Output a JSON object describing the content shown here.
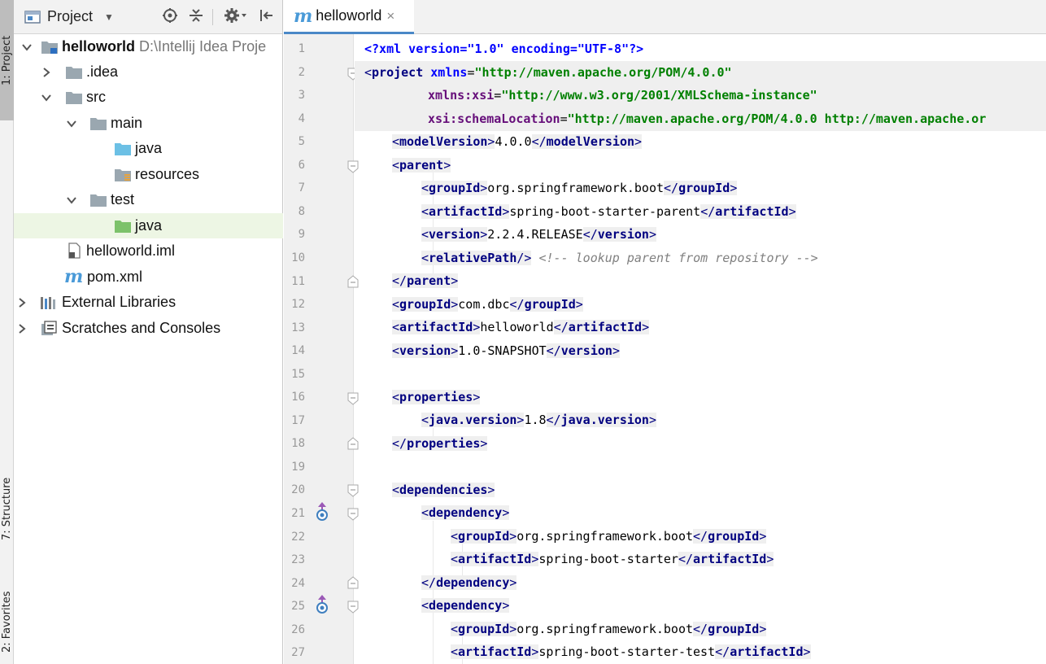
{
  "strip": {
    "tab_project": "1: Project",
    "tab_structure": "7: Structure",
    "tab_favorites": "2: Favorites"
  },
  "project_panel": {
    "title": "Project",
    "tree": [
      {
        "label": "helloworld",
        "extra": "D:\\Intellij Idea Proje",
        "bold": true
      },
      {
        "label": ".idea"
      },
      {
        "label": "src"
      },
      {
        "label": "main"
      },
      {
        "label": "java"
      },
      {
        "label": "resources"
      },
      {
        "label": "test"
      },
      {
        "label": "java"
      },
      {
        "label": "helloworld.iml"
      },
      {
        "label": "pom.xml"
      },
      {
        "label": "External Libraries"
      },
      {
        "label": "Scratches and Consoles"
      }
    ]
  },
  "editor": {
    "tab_title": "helloworld",
    "tab_glyph": "m",
    "close_glyph": "×",
    "line_numbers": [
      "1",
      "2",
      "3",
      "4",
      "5",
      "6",
      "7",
      "8",
      "9",
      "10",
      "11",
      "12",
      "13",
      "14",
      "15",
      "16",
      "17",
      "18",
      "19",
      "20",
      "21",
      "22",
      "23",
      "24",
      "25",
      "26",
      "27"
    ]
  },
  "code_text": {
    "l1_decl": "<?xml version=\"1.0\" encoding=\"UTF-8\"?>",
    "l2_project": "project",
    "l2_xmlns": "xmlns",
    "l2_xmlns_val": "\"http://maven.apache.org/POM/4.0.0\"",
    "l3_xsi": "xmlns:xsi",
    "l3_xsi_val": "\"http://www.w3.org/2001/XMLSchema-instance\"",
    "l4_schema": "xsi:schemaLocation",
    "l4_schema_val": "\"http://maven.apache.org/POM/4.0.0 http://maven.apache.or",
    "modelVersion": "modelVersion",
    "modelVersion_val": "4.0.0",
    "parent": "parent",
    "groupId": "groupId",
    "parent_groupId_val": "org.springframework.boot",
    "artifactId": "artifactId",
    "parent_artifactId_val": "spring-boot-starter-parent",
    "version": "version",
    "parent_version_val": "2.2.4.RELEASE",
    "relativePath": "relativePath",
    "comment": "<!-- lookup parent from repository -->",
    "groupId_val": "com.dbc",
    "artifactId_val": "helloworld",
    "version_val": "1.0-SNAPSHOT",
    "properties": "properties",
    "java_version": "java.version",
    "java_version_val": "1.8",
    "dependencies": "dependencies",
    "dependency": "dependency",
    "dep1_groupId_val": "org.springframework.boot",
    "dep1_artifactId_val": "spring-boot-starter",
    "dep2_groupId_val": "org.springframework.boot",
    "dep2_artifactId_val": "spring-boot-starter-test"
  },
  "colors": {
    "tag": "#000080",
    "attribute": "#0000ff",
    "namespace": "#660e7a",
    "string": "#008000",
    "comment": "#808080",
    "selection": "#edf6e4",
    "accent": "#4a88c7"
  }
}
